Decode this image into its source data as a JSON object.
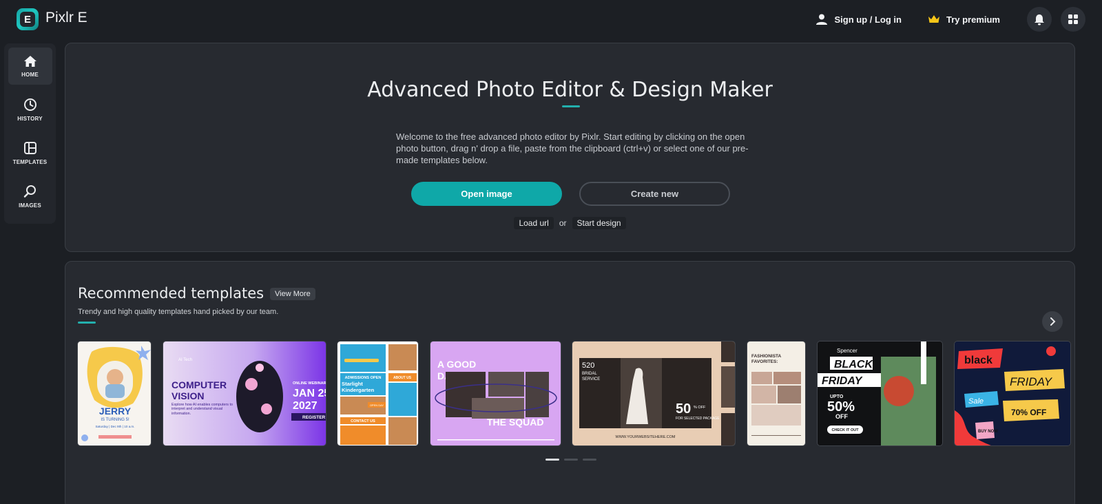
{
  "app": {
    "title": "Pixlr E",
    "logo_letter": "E"
  },
  "header": {
    "signin_label": "Sign up / Log in",
    "premium_label": "Try premium"
  },
  "sidebar": {
    "items": [
      {
        "label": "HOME",
        "icon": "home-icon",
        "active": true
      },
      {
        "label": "HISTORY",
        "icon": "history-icon"
      },
      {
        "label": "TEMPLATES",
        "icon": "templates-icon"
      },
      {
        "label": "IMAGES",
        "icon": "search-icon"
      }
    ]
  },
  "hero": {
    "title": "Advanced Photo Editor & Design Maker",
    "description": "Welcome to the free advanced photo editor by Pixlr. Start editing by clicking on the open photo button, drag n' drop a file, paste from the clipboard (ctrl+v) or select one of our pre-made templates below.",
    "open_label": "Open image",
    "create_label": "Create new",
    "load_url_label": "Load url",
    "or_label": "or",
    "start_design_label": "Start design"
  },
  "templates": {
    "title": "Recommended templates",
    "view_more_label": "View More",
    "subtitle": "Trendy and high quality templates hand picked by our team.",
    "cards": [
      {
        "texts": [
          "JERRY",
          "IS TURNING 5!",
          "Saturday | Dec 9th | 10 a.m."
        ]
      },
      {
        "texts": [
          "AI Tech",
          "COMPUTER",
          "VISION",
          "Explore how AI enables computers to interpret and understand visual information.",
          "ONLINE WEBINAR",
          "JAN 25",
          "2027",
          "REGISTER"
        ]
      },
      {
        "texts": [
          "ADMISSIONS OPEN",
          "Starlight Kindergarten",
          "ABOUT US",
          "OPEN DAY",
          "CONTACT US"
        ]
      },
      {
        "texts": [
          "A GOOD",
          "DAY WITH",
          "THE SQUAD"
        ]
      },
      {
        "texts": [
          "520",
          "BRIDAL",
          "SERVICE",
          "50",
          "% OFF",
          "FOR SELECTED PACKAGE",
          "WWW.YOURWEBSITEHERE.COM"
        ]
      },
      {
        "texts": [
          "FASHIONISTA",
          "FAVORITES:"
        ]
      },
      {
        "texts": [
          "Spencer",
          "BLACK",
          "FRIDAY",
          "UPTO",
          "50%",
          "OFF",
          "CHECK IT OUT"
        ]
      },
      {
        "texts": [
          "black",
          "FRIDAY",
          "Sale",
          "70% OFF",
          "BUY NOW"
        ]
      }
    ]
  },
  "pagination": {
    "pages": 3,
    "active": 0
  },
  "colors": {
    "accent": "#0fa8a8",
    "background": "#1c1f24",
    "panel": "#272a30"
  }
}
